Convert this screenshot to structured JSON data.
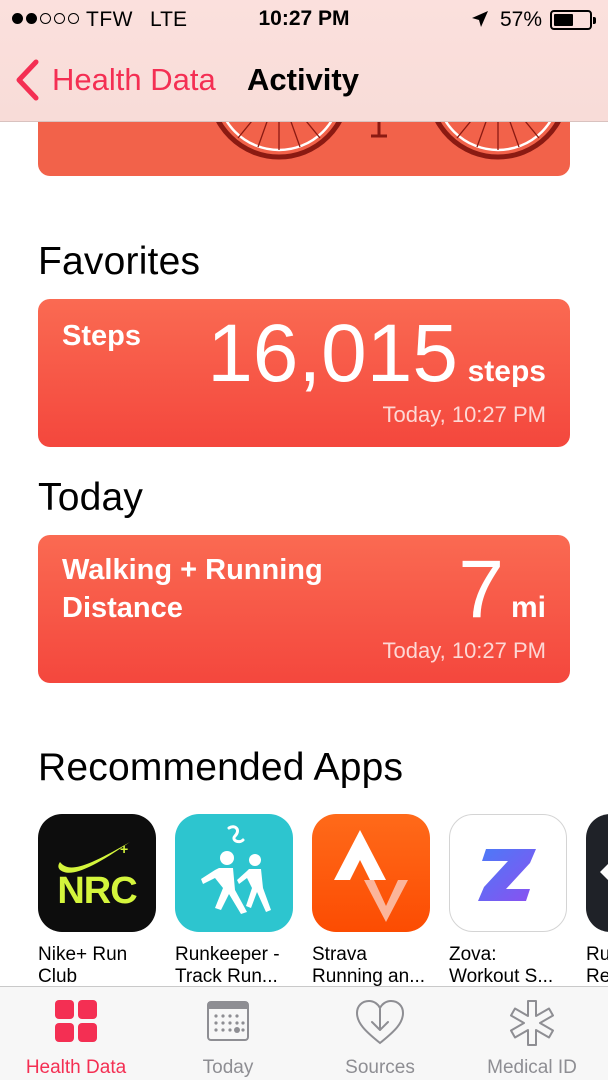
{
  "status_bar": {
    "carrier": "TFW",
    "network": "LTE",
    "time": "10:27 PM",
    "battery": "57%",
    "battery_level": 0.57,
    "signal_bars_filled": 2,
    "signal_bars_total": 5
  },
  "nav": {
    "back_label": "Health Data",
    "title": "Activity"
  },
  "sections": {
    "favorites": "Favorites",
    "today": "Today",
    "recommended": "Recommended Apps"
  },
  "favorites_card": {
    "label": "Steps",
    "value": "16,015",
    "unit": "steps",
    "timestamp": "Today, 10:27 PM"
  },
  "today_card": {
    "label_line1": "Walking + Running",
    "label_line2": "Distance",
    "value": "7",
    "unit": "mi",
    "timestamp": "Today, 10:27 PM"
  },
  "apps": [
    {
      "name": "Nike+ Run",
      "sub": "Club",
      "icon_text": "NRC",
      "icon": "nike-swoosh-icon"
    },
    {
      "name": "Runkeeper -",
      "sub": "Track Run...",
      "icon": "runners-icon"
    },
    {
      "name": "Strava",
      "sub": "Running an...",
      "icon": "strava-chevrons-icon"
    },
    {
      "name": "Zova:",
      "sub": "Workout S...",
      "icon": "zova-z-icon"
    },
    {
      "name": "Ru",
      "sub": "Re",
      "icon": "partial-app-icon"
    }
  ],
  "tabs": [
    {
      "label": "Health Data",
      "icon": "health-data-grid-icon",
      "active": true
    },
    {
      "label": "Today",
      "icon": "calendar-icon",
      "active": false
    },
    {
      "label": "Sources",
      "icon": "sources-heart-icon",
      "active": false
    },
    {
      "label": "Medical ID",
      "icon": "medical-star-icon",
      "active": false
    }
  ],
  "colors": {
    "accent": "#f42f53",
    "card_top": "#fa6a52",
    "card_bottom": "#f4473d"
  }
}
